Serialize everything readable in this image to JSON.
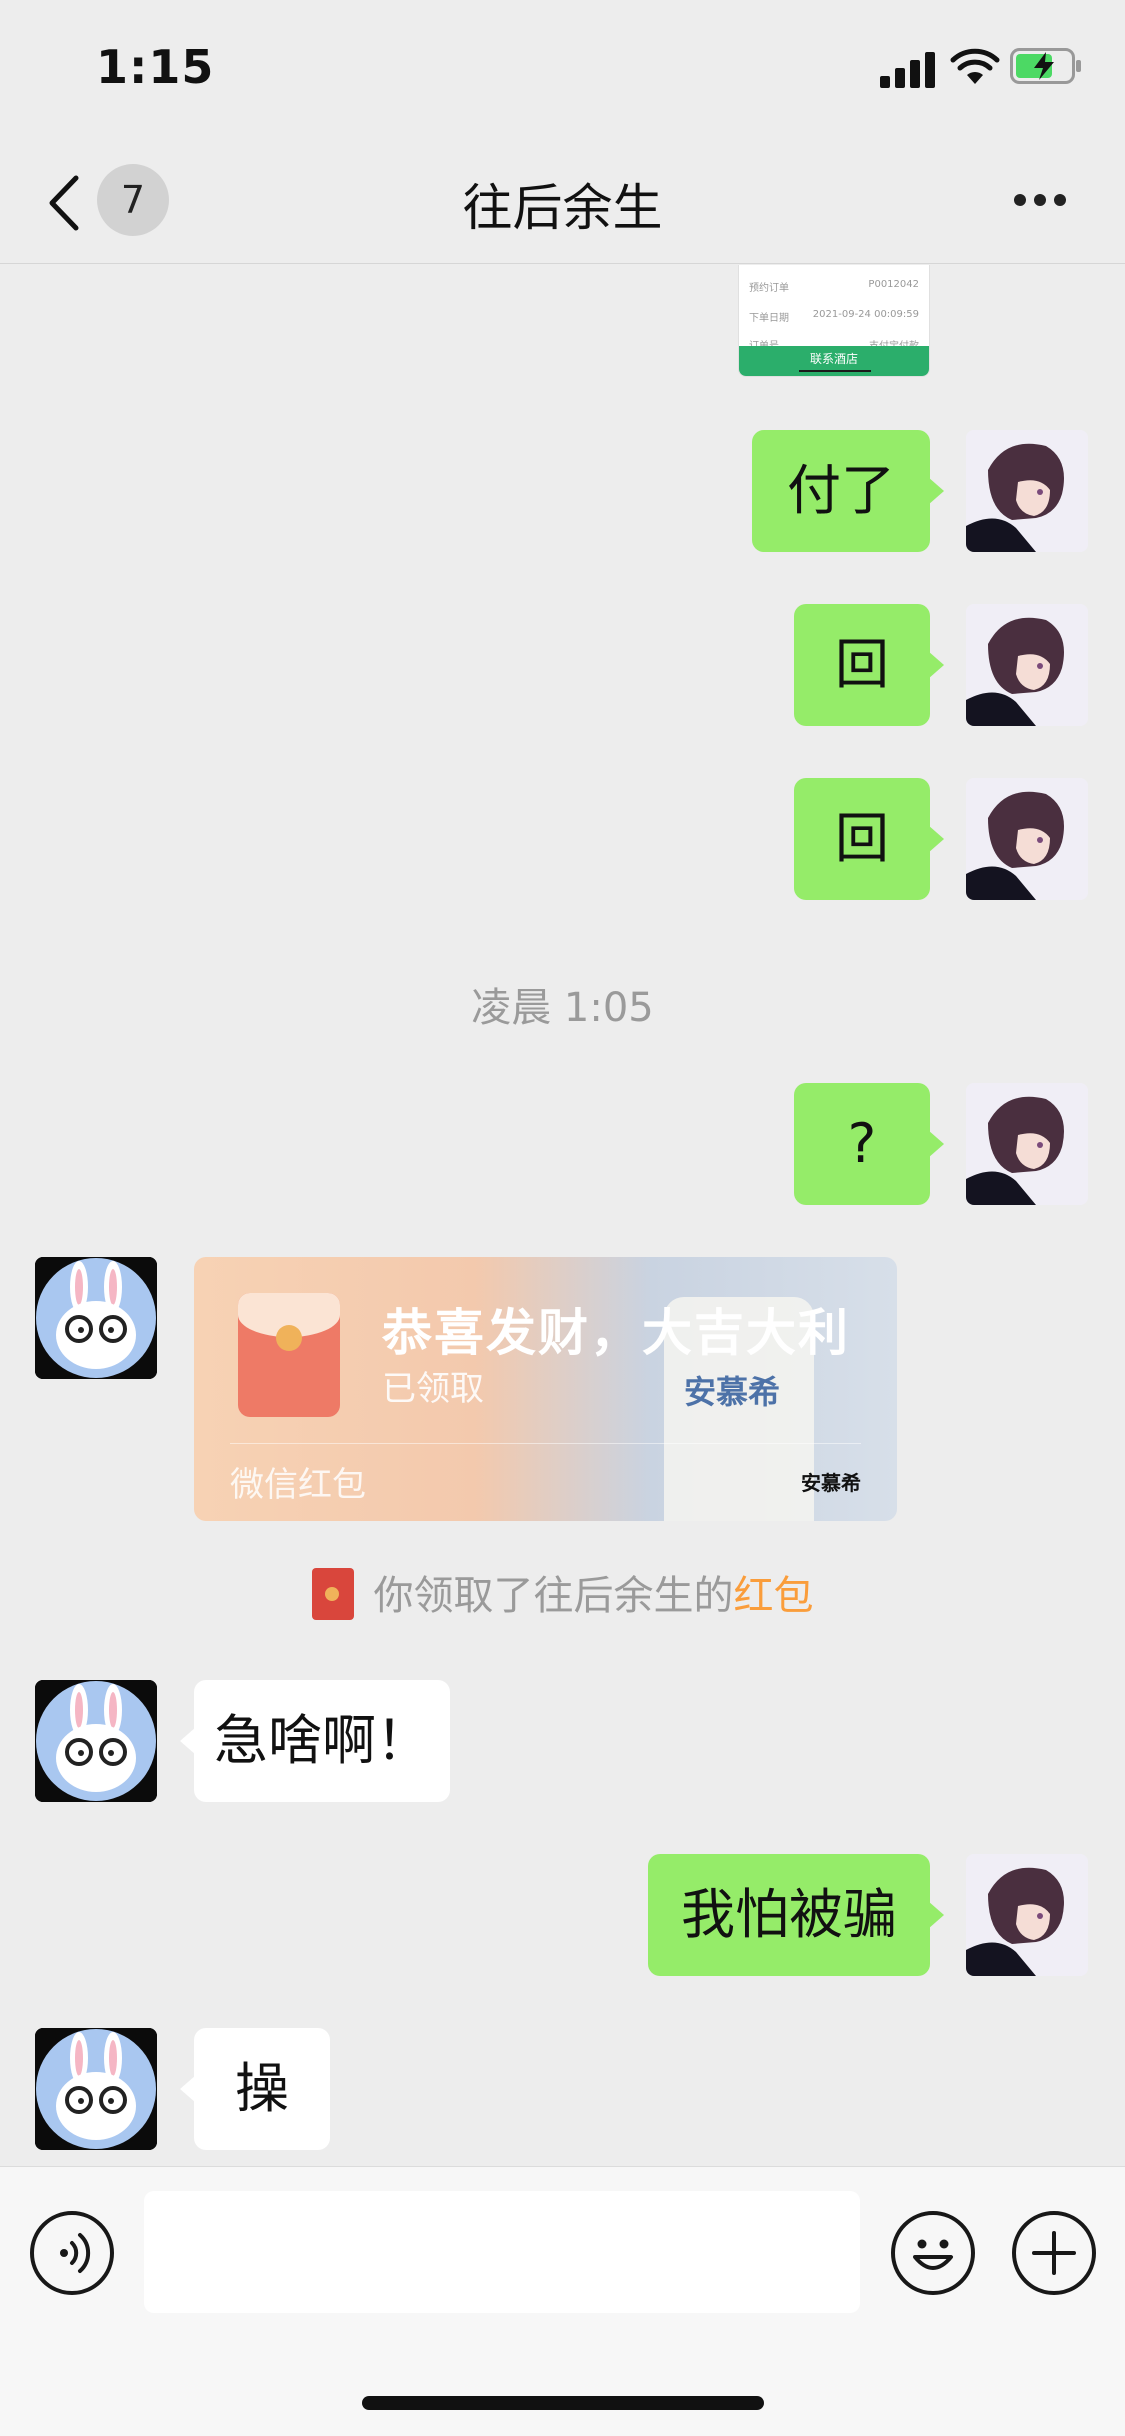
{
  "status_bar": {
    "time": "1:15"
  },
  "nav": {
    "back_count": "7",
    "title": "往后余生",
    "more_icon": "more-icon"
  },
  "previous_card": {
    "rows": [
      "预约订单",
      "P0012042",
      "下单日期",
      "2021-09-24 00:09:59",
      "订单号",
      "支付宝付款"
    ],
    "button": "联系酒店"
  },
  "messages": [
    {
      "from": "me",
      "text": "付了"
    },
    {
      "from": "me",
      "text": "回"
    },
    {
      "from": "me",
      "text": "回"
    },
    {
      "type": "time",
      "text": "凌晨 1:05"
    },
    {
      "from": "me",
      "text": "?"
    },
    {
      "from": "other",
      "type": "red_packet",
      "title": "恭喜发财，大吉大利",
      "status": "已领取",
      "footer": "微信红包",
      "brand": "安慕希"
    },
    {
      "type": "notice",
      "text_prefix": "你领取了往后余生的",
      "text_highlight": "红包"
    },
    {
      "from": "other",
      "text": "急啥啊！"
    },
    {
      "from": "me",
      "text": "我怕被骗"
    },
    {
      "from": "other",
      "text": "操"
    }
  ],
  "colors": {
    "bubble_me": "#95ec69",
    "bubble_other": "#ffffff",
    "background": "#ededed",
    "highlight": "#fa9d3b"
  },
  "input_bar": {
    "voice_icon": "voice-icon",
    "emoji_icon": "emoji-icon",
    "plus_icon": "plus-icon",
    "value": ""
  }
}
